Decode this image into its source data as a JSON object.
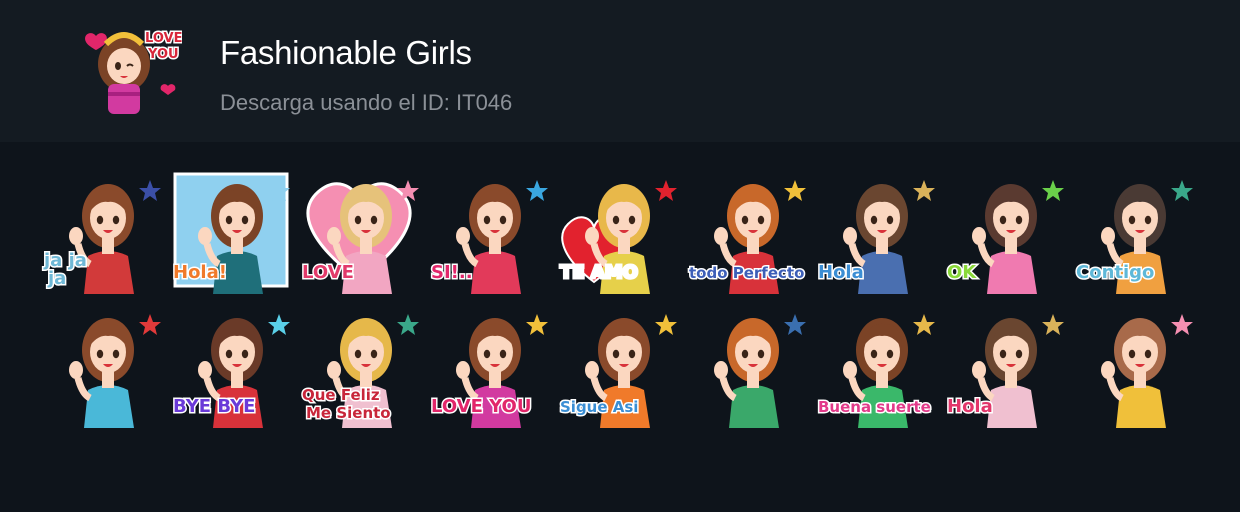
{
  "pack": {
    "title": "Fashionable Girls",
    "subtitle": "Descarga usando el ID: IT046",
    "icon": {
      "name": "pack-thumbnail-icon",
      "caption_line1": "LOVE",
      "caption_line2": "YOU"
    }
  },
  "stickers": [
    {
      "name": "sticker-jajaja",
      "caption": "ja ja ja",
      "caption_color": "#6fb8d6",
      "hair": "#8a4a2b",
      "top": "#d23a3a",
      "accent": "#3b4fa8"
    },
    {
      "name": "sticker-hola-window",
      "caption": "Hola!",
      "caption_color": "#f07a2a",
      "hair": "#7b4326",
      "top": "#1f6f7a",
      "accent": "#8fd0ef"
    },
    {
      "name": "sticker-love",
      "caption": "LOVE",
      "caption_color": "#e23a6a",
      "hair": "#e6c27a",
      "top": "#f2a6c2",
      "accent": "#f58fb2"
    },
    {
      "name": "sticker-si",
      "caption": "SI!..",
      "caption_color": "#e2266a",
      "hair": "#8a4a2b",
      "top": "#e23a5a",
      "accent": "#3aa7e0"
    },
    {
      "name": "sticker-te-amo",
      "caption": "TE AMO",
      "caption_color": "#ffffff",
      "hair": "#e8b84a",
      "top": "#e6d04a",
      "accent": "#e2222e"
    },
    {
      "name": "sticker-todo-perfecto",
      "caption": "todo Perfecto",
      "caption_color": "#3d5fb8",
      "hair": "#c8682a",
      "top": "#d8323a",
      "accent": "#f0c03a"
    },
    {
      "name": "sticker-hola-hat",
      "caption": "Hola",
      "caption_color": "#3b8ed4",
      "hair": "#6a4630",
      "top": "#4a6fb0",
      "accent": "#d9b25a"
    },
    {
      "name": "sticker-ok",
      "caption": "OK",
      "caption_color": "#8ad83a",
      "hair": "#5a3a30",
      "top": "#f07ab0",
      "accent": "#6ad04a"
    },
    {
      "name": "sticker-contigo",
      "caption": "Contigo",
      "caption_color": "#5fb8d8",
      "hair": "#4a3a34",
      "top": "#f0a040",
      "accent": "#3aa88a"
    },
    {
      "name": "sticker-bow",
      "caption": "",
      "caption_color": "#f0c03a",
      "hair": "#8a4a2b",
      "top": "#4ab8d8",
      "accent": "#e23a3a"
    },
    {
      "name": "sticker-bye-bye",
      "caption": "BYE BYE",
      "caption_color": "#6a3ad8",
      "hair": "#6a3a28",
      "top": "#d8323a",
      "accent": "#5ad0e8"
    },
    {
      "name": "sticker-que-feliz",
      "caption": "Que Feliz Me Siento",
      "caption_color": "#c8263a",
      "hair": "#e6b84a",
      "top": "#f0c0d0",
      "accent": "#3aa88a"
    },
    {
      "name": "sticker-love-you",
      "caption": "LOVE YOU",
      "caption_color": "#e2266a",
      "hair": "#8a4a2b",
      "top": "#d23aa0",
      "accent": "#f2c03a"
    },
    {
      "name": "sticker-sigue-asi",
      "caption": "Sigue Asi",
      "caption_color": "#3a8ed4",
      "hair": "#8a4a2b",
      "top": "#f07a2a",
      "accent": "#f0c03a"
    },
    {
      "name": "sticker-coffee",
      "caption": "",
      "caption_color": "#ffffff",
      "hair": "#c8682a",
      "top": "#3aa86a",
      "accent": "#3a6fb0"
    },
    {
      "name": "sticker-buena-suerte",
      "caption": "Buena suerte",
      "caption_color": "#e23a8a",
      "hair": "#7b4326",
      "top": "#3ab86a",
      "accent": "#e6b84a"
    },
    {
      "name": "sticker-hola-bunny",
      "caption": "Hola",
      "caption_color": "#e2366a",
      "hair": "#6a4630",
      "top": "#f0c0d0",
      "accent": "#d9b25a"
    },
    {
      "name": "sticker-crying",
      "caption": "",
      "caption_color": "#e2266a",
      "hair": "#a86a4a",
      "top": "#f0c03a",
      "accent": "#f58fb2"
    }
  ]
}
